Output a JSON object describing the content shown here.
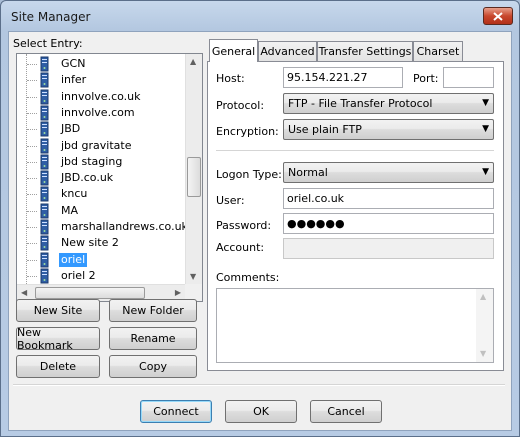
{
  "window": {
    "title": "Site Manager"
  },
  "tree": {
    "label": "Select Entry:",
    "items": [
      {
        "label": "GCN",
        "selected": false
      },
      {
        "label": "infer",
        "selected": false
      },
      {
        "label": "innvolve.co.uk",
        "selected": false
      },
      {
        "label": "innvolve.com",
        "selected": false
      },
      {
        "label": "JBD",
        "selected": false
      },
      {
        "label": "jbd gravitate",
        "selected": false
      },
      {
        "label": "jbd staging",
        "selected": false
      },
      {
        "label": "JBD.co.uk",
        "selected": false
      },
      {
        "label": "kncu",
        "selected": false
      },
      {
        "label": "MA",
        "selected": false
      },
      {
        "label": "marshallandrews.co.uk",
        "selected": false
      },
      {
        "label": "New site 2",
        "selected": false
      },
      {
        "label": "oriel",
        "selected": true
      },
      {
        "label": "oriel 2",
        "selected": false
      }
    ]
  },
  "left_buttons": {
    "new_site": "New Site",
    "new_folder": "New Folder",
    "new_bookmark": "New Bookmark",
    "rename": "Rename",
    "delete": "Delete",
    "copy": "Copy"
  },
  "tabs": [
    "General",
    "Advanced",
    "Transfer Settings",
    "Charset"
  ],
  "form": {
    "host_label": "Host:",
    "host_value": "95.154.221.27",
    "port_label": "Port:",
    "port_value": "",
    "protocol_label": "Protocol:",
    "protocol_value": "FTP - File Transfer Protocol",
    "encryption_label": "Encryption:",
    "encryption_value": "Use plain FTP",
    "logon_type_label": "Logon Type:",
    "logon_type_value": "Normal",
    "user_label": "User:",
    "user_value": "oriel.co.uk",
    "password_label": "Password:",
    "password_value": "●●●●●●",
    "account_label": "Account:",
    "account_value": "",
    "comments_label": "Comments:",
    "comments_value": ""
  },
  "bottom_buttons": {
    "connect": "Connect",
    "ok": "OK",
    "cancel": "Cancel"
  },
  "icons": {
    "tree_item": "server-icon",
    "close": "close-icon"
  },
  "colors": {
    "selection": "#3399ff",
    "close_button": "#c8472d"
  }
}
